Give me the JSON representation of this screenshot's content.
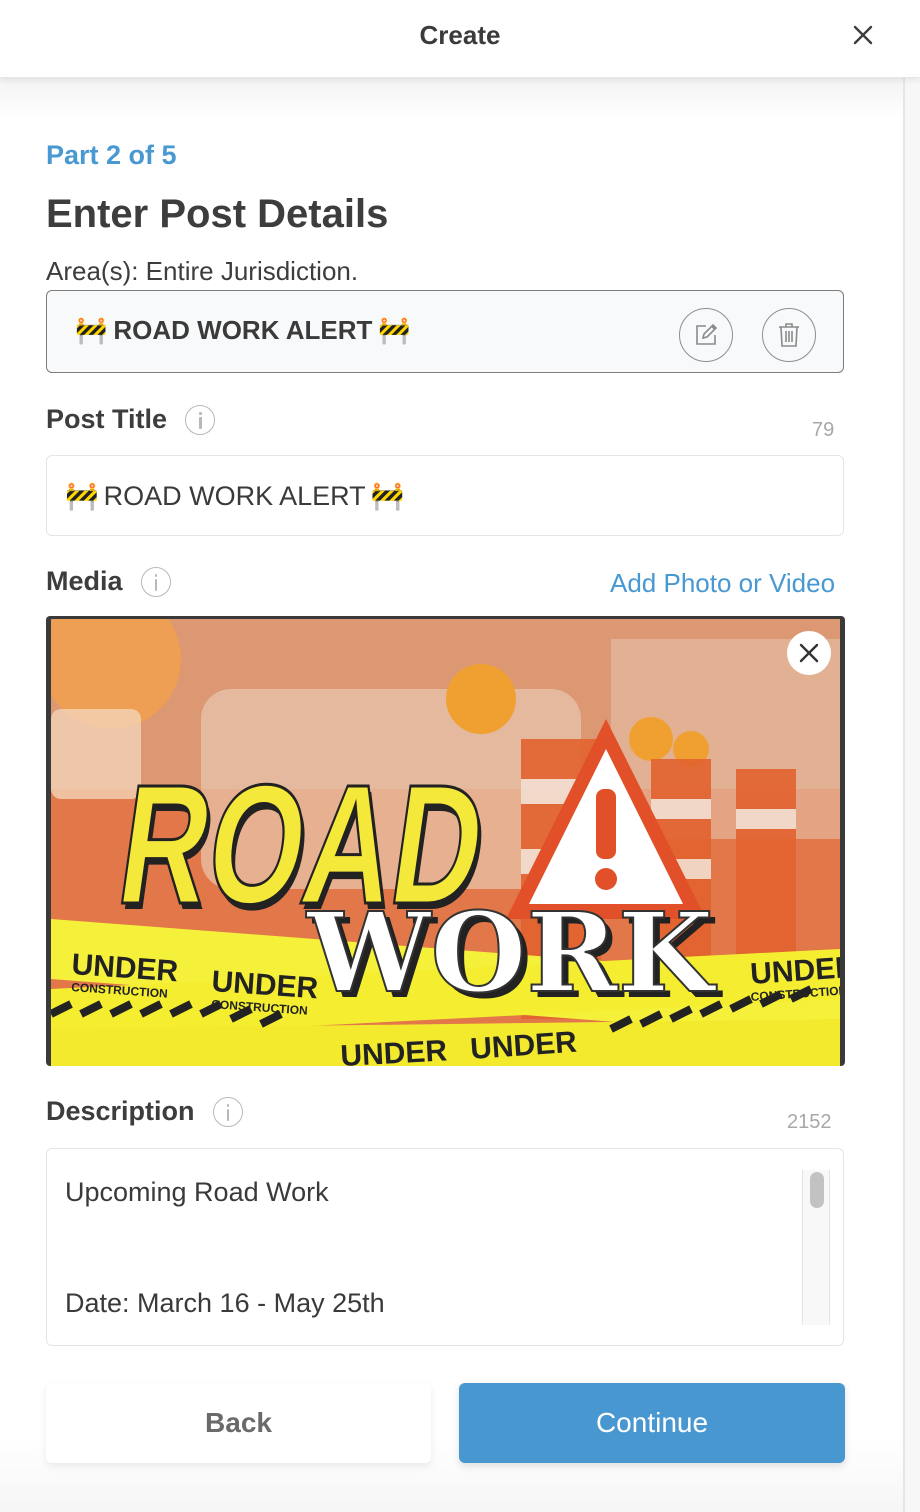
{
  "header": {
    "title": "Create",
    "close_icon": "close-icon"
  },
  "form": {
    "step": "Part 2 of 5",
    "title": "Enter Post Details",
    "area": "Area(s): Entire Jurisdiction.",
    "template": {
      "emoji": "🚧",
      "text": "ROAD WORK ALERT",
      "edit_icon": "edit-icon",
      "delete_icon": "trash-icon"
    },
    "post_title": {
      "label": "Post Title",
      "counter": "79",
      "emoji": "🚧",
      "value": "ROAD WORK ALERT"
    },
    "media": {
      "label": "Media",
      "add_link": "Add Photo or Video",
      "image": {
        "word1": "ROAD",
        "word2": "WORK",
        "tape_main": "UNDER",
        "tape_sub": "CONSTRUCTION"
      }
    },
    "description": {
      "label": "Description",
      "counter": "2152",
      "lines": [
        "Upcoming Road Work",
        "Date: March 16 - May 25th"
      ]
    }
  },
  "actions": {
    "back": "Back",
    "continue": "Continue"
  },
  "colors": {
    "accent": "#4898d2",
    "text": "#3d3d3d",
    "muted": "#a8a8a8"
  }
}
